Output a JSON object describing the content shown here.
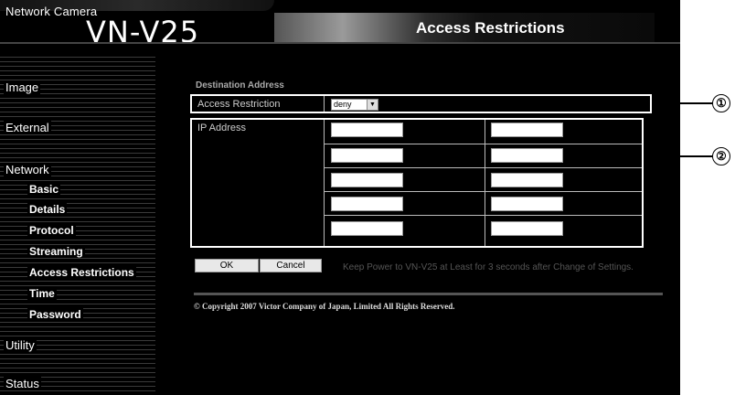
{
  "header": {
    "brand_small": "Network Camera",
    "brand_model": "VN-V25",
    "page_title": "Access Restrictions"
  },
  "sidebar": {
    "items": [
      {
        "label": "Image"
      },
      {
        "label": "External"
      },
      {
        "label": "Network"
      },
      {
        "label": "Basic"
      },
      {
        "label": "Details"
      },
      {
        "label": "Protocol"
      },
      {
        "label": "Streaming"
      },
      {
        "label": "Access Restrictions"
      },
      {
        "label": "Time"
      },
      {
        "label": "Password"
      },
      {
        "label": "Utility"
      },
      {
        "label": "Status"
      }
    ]
  },
  "main": {
    "section_title": "Destination Address",
    "access_restriction_label": "Access Restriction",
    "access_restriction_value": "deny",
    "ip_address_label": "IP Address",
    "ip_values": [
      "",
      "",
      "",
      "",
      "",
      "",
      "",
      "",
      "",
      ""
    ],
    "ok_label": "OK",
    "cancel_label": "Cancel",
    "note": "Keep Power to VN-V25 at Least for 3 seconds after Change of Settings.",
    "copyright": "© Copyright 2007 Victor Company of Japan, Limited All Rights Reserved."
  },
  "callouts": [
    "①",
    "②"
  ],
  "colors": {
    "background": "#000000",
    "text": "#ffffff",
    "muted_text": "#555555"
  }
}
